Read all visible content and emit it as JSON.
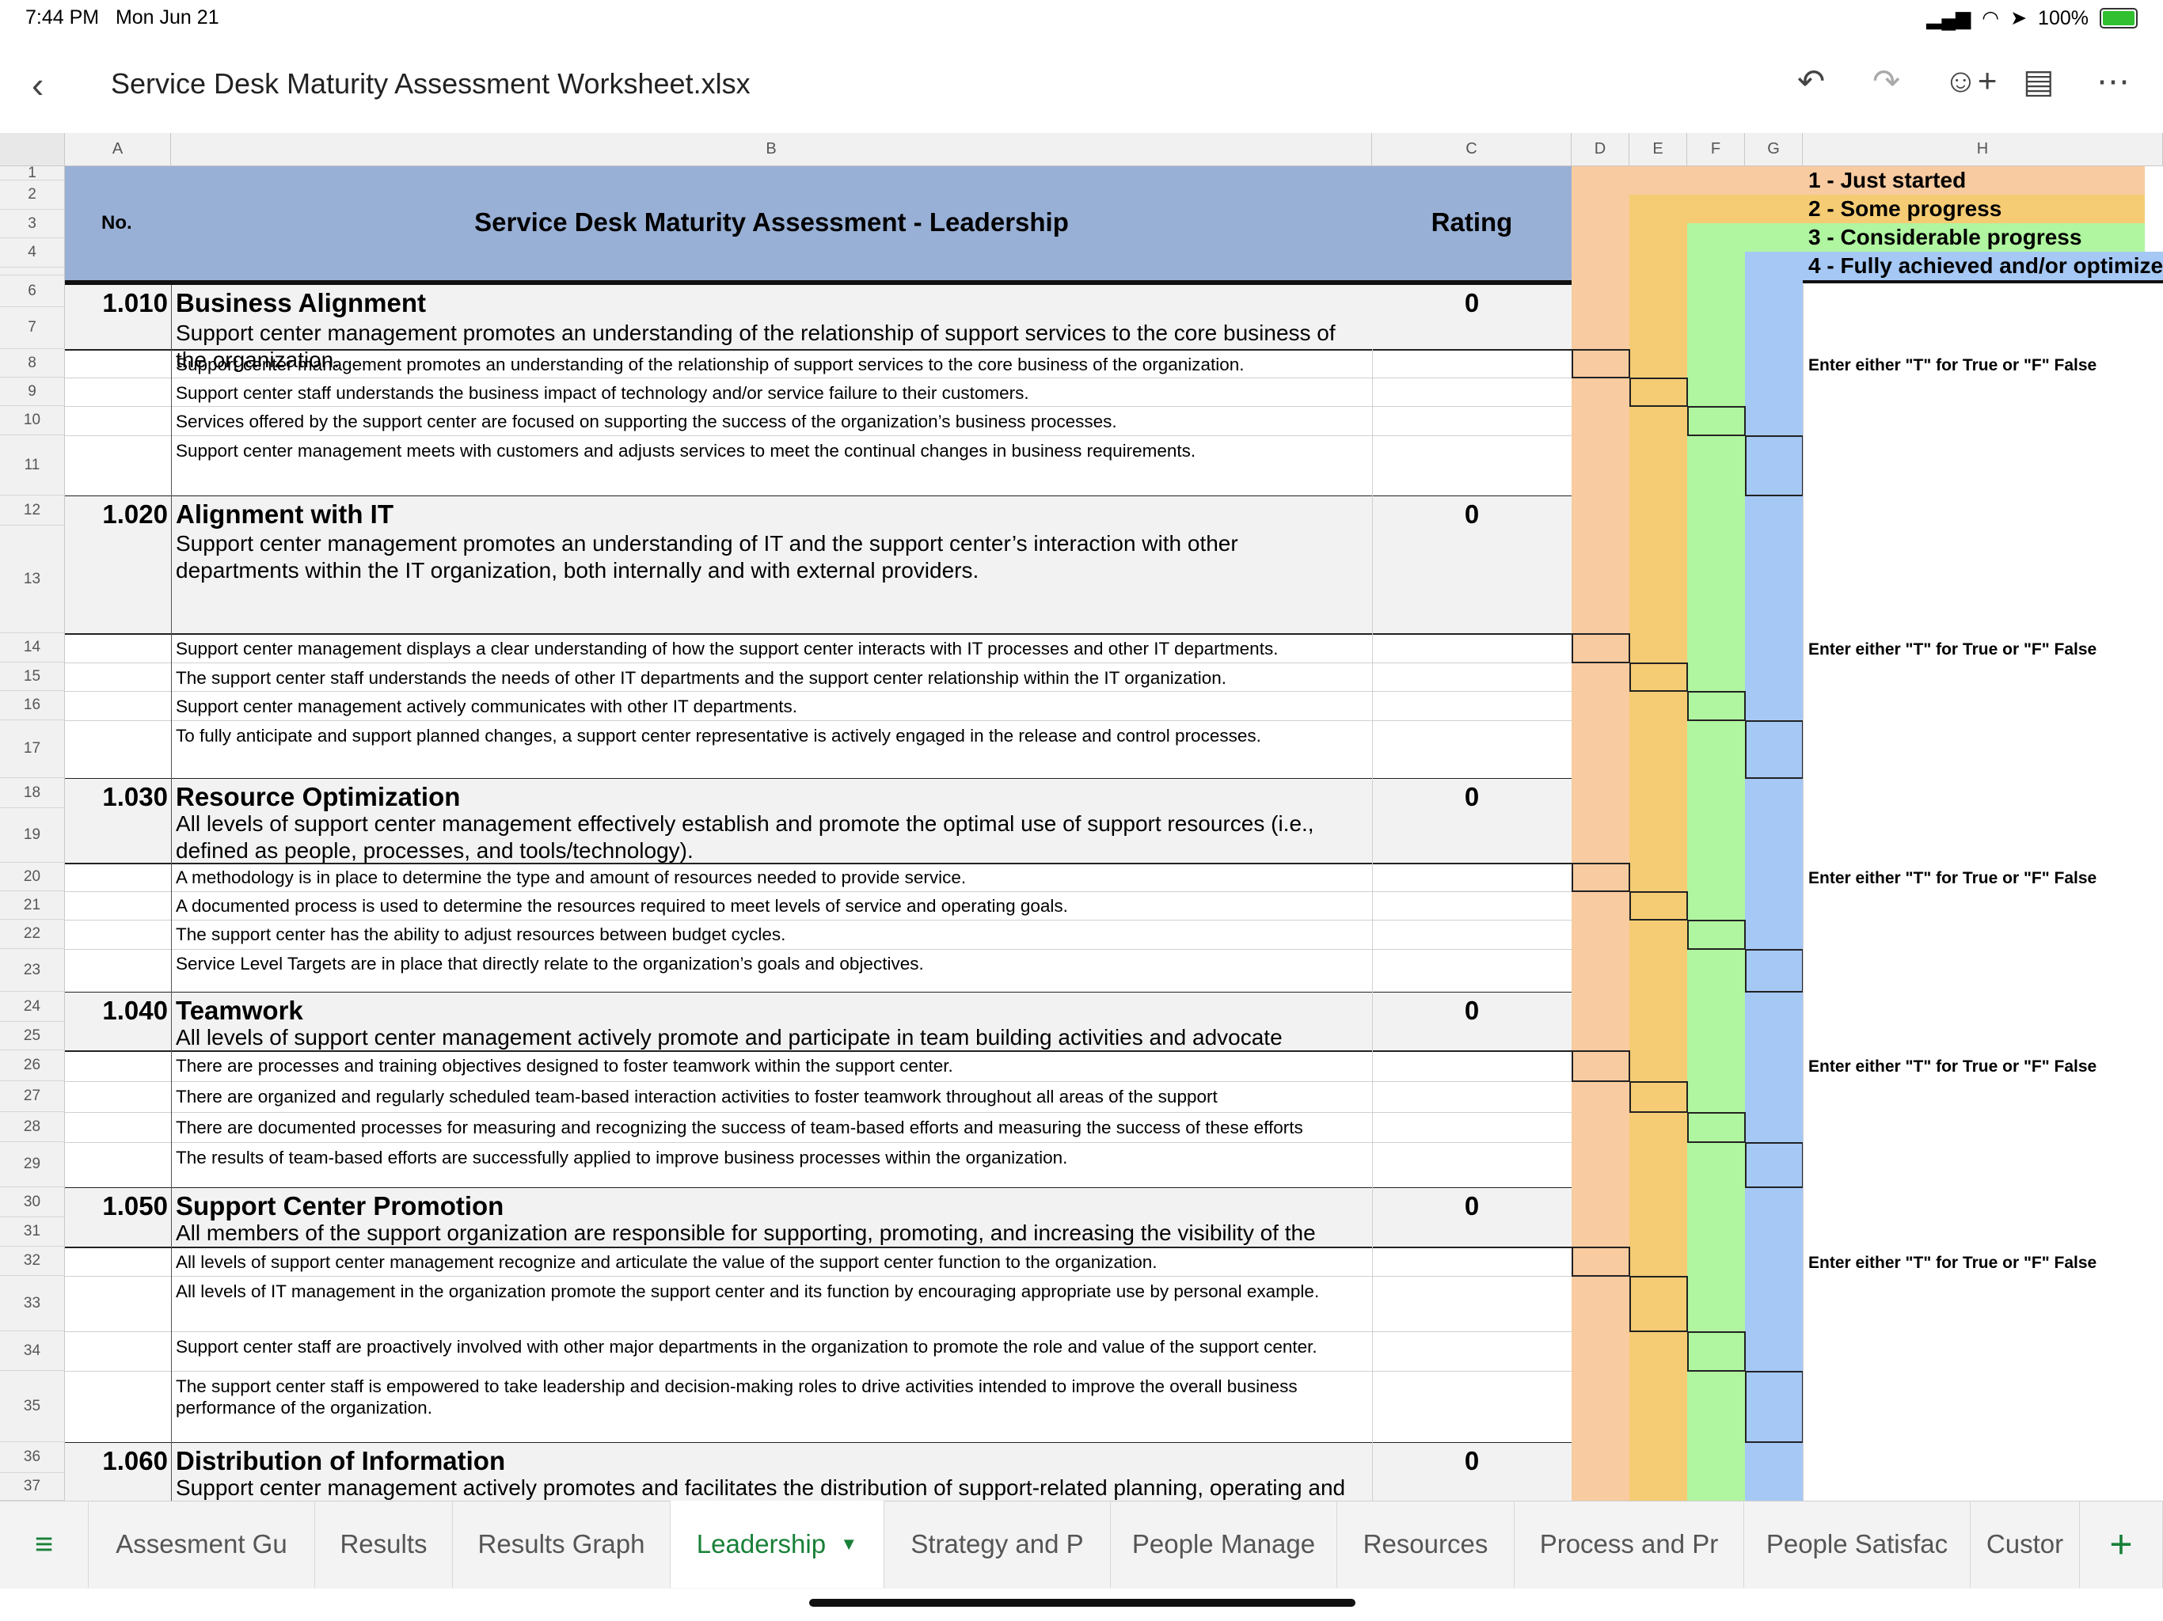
{
  "status_bar": {
    "time": "7:44 PM",
    "date": "Mon Jun 21",
    "battery": "100%"
  },
  "title_bar": {
    "title": "Service Desk Maturity Assessment Worksheet.xlsx"
  },
  "column_headers": [
    "A",
    "B",
    "C",
    "D",
    "E",
    "F",
    "G",
    "H"
  ],
  "header": {
    "no_label": "No.",
    "title": "Service Desk Maturity Assessment - Leadership",
    "rating_label": "Rating"
  },
  "legend": [
    "1 - Just started",
    "2 - Some progress",
    "3 - Considerable progress",
    "4 - Fully achieved and/or optimize"
  ],
  "level_colors": {
    "1": "#f8cba0",
    "2": "#f5cc74",
    "3": "#b0f5a0",
    "4": "#a5c8f5"
  },
  "header_color": "#99b0d6",
  "note": "Enter either \"T\" for True or \"F\" False",
  "sections": [
    {
      "no": "1.010",
      "title": "Business Alignment",
      "rating": "0",
      "desc": "Support center management promotes an understanding of the relationship of support services to the core business of the organization.",
      "items": [
        "Support center management promotes an understanding of the relationship of support services to the core business of the organization.",
        "Support center staff understands the business impact of technology and/or service failure to their customers.",
        "Services offered by the support center are focused on supporting the success of the organization’s business processes.",
        "Support center management meets with customers and adjusts services to meet the continual changes in business requirements."
      ]
    },
    {
      "no": "1.020",
      "title": "Alignment with IT",
      "rating": "0",
      "desc": "Support center management promotes an understanding of IT and the support center’s interaction with other departments within the IT organization, both internally and with external providers.",
      "items": [
        "Support center management displays a clear understanding of how the support center interacts with IT processes and other IT departments.",
        "The support center staff understands the needs of other IT departments and the support center relationship within the IT organization.",
        "Support center management actively communicates with other IT departments.",
        "To fully anticipate and support planned changes, a support center representative is actively engaged in the release and control processes."
      ]
    },
    {
      "no": "1.030",
      "title": "Resource Optimization",
      "rating": "0",
      "desc": "All levels of support center management effectively establish and promote the optimal use of support resources (i.e., defined as people, processes, and tools/technology).",
      "items": [
        "A methodology is in place to determine the type and amount of resources needed to provide service.",
        "A documented process is used to determine the resources required to meet levels of service and operating goals.",
        "The support center has the ability to adjust resources between budget cycles.",
        "Service Level Targets are in place that directly relate to the organization’s goals and objectives."
      ]
    },
    {
      "no": "1.040",
      "title": "Teamwork",
      "rating": "0",
      "desc": "All levels of support center management actively promote and participate in team building activities and advocate",
      "items": [
        "There are processes and training objectives designed to foster teamwork within the support center.",
        "There are organized and regularly scheduled team-based interaction activities to foster teamwork throughout all areas of the support",
        "There are documented processes for measuring and recognizing the success of team-based efforts and measuring the success of these efforts",
        "The results of team-based efforts are successfully applied to improve business processes within the organization."
      ]
    },
    {
      "no": "1.050",
      "title": "Support Center Promotion",
      "rating": "0",
      "desc": "All members of the support organization are responsible for supporting, promoting, and increasing the visibility of the",
      "items": [
        "All levels of support center management recognize and articulate the value of the support center function to the organization.",
        "All levels of IT management in the organization promote the support center and its function by encouraging appropriate use by personal example.",
        "Support center staff are proactively involved with other major departments in the organization to promote the role and value of the support center.",
        "The support center staff is empowered to take leadership and decision-making roles to drive activities intended to improve the overall business performance of the organization."
      ]
    },
    {
      "no": "1.060",
      "title": "Distribution of Information",
      "rating": "0",
      "desc": "Support center management actively promotes and facilitates the distribution of support-related planning, operating and",
      "items": []
    }
  ],
  "row_numbers": [
    "1",
    "2",
    "3",
    "4",
    "6",
    "7",
    "8",
    "9",
    "10",
    "11",
    "12",
    "13",
    "14",
    "15",
    "16",
    "17",
    "18",
    "19",
    "20",
    "21",
    "22",
    "23",
    "24",
    "25",
    "26",
    "27",
    "28",
    "29",
    "30",
    "31",
    "32",
    "33",
    "34",
    "35",
    "36",
    "37"
  ],
  "tabs": [
    "Assesment Gu",
    "Results",
    "Results Graph",
    "Leadership",
    "Strategy and P",
    "People Manage",
    "Resources",
    "Process and Pr",
    "People Satisfac",
    "Custor"
  ],
  "active_tab": "Leadership"
}
